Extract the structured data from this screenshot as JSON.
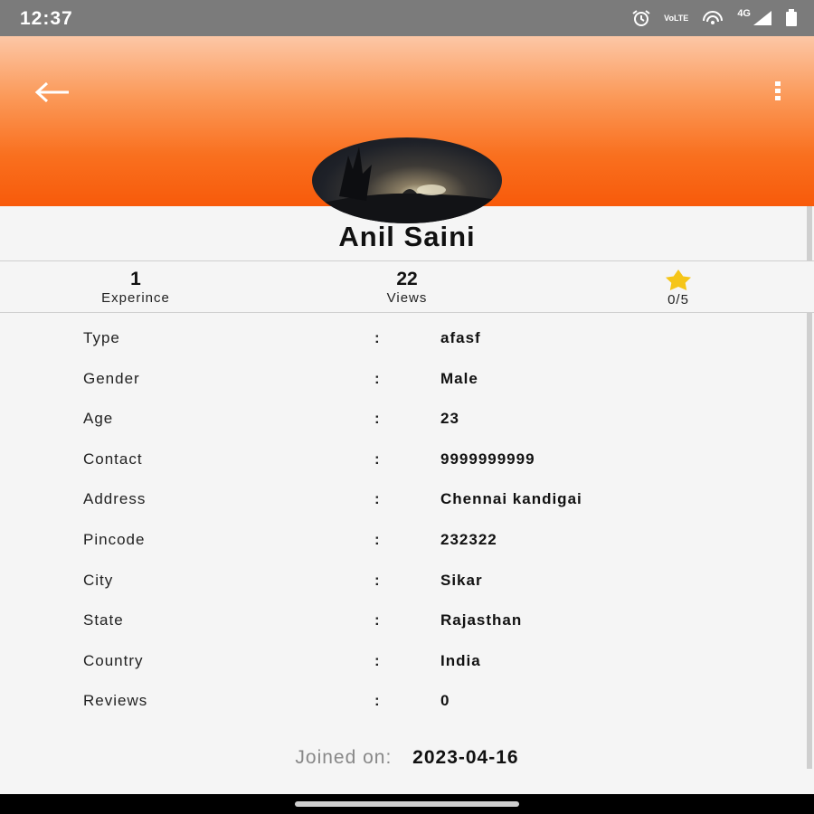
{
  "status_bar": {
    "time": "12:37",
    "icons": [
      "alarm-icon",
      "volte-icon",
      "hotspot-icon",
      "4g-signal-icon",
      "battery-icon"
    ],
    "network_label": "4G",
    "volte_label": "VoLTE"
  },
  "header": {
    "back_icon": "arrow-left-icon",
    "menu_icon": "more-vertical-icon",
    "gradient_colors": [
      "#fcc7a6",
      "#f85a0a"
    ]
  },
  "profile": {
    "name": "Anil Saini"
  },
  "stats": {
    "experience": {
      "value": "1",
      "label": "Experince"
    },
    "views": {
      "value": "22",
      "label": "Views"
    },
    "rating": {
      "label": "0/5",
      "icon": "star-icon",
      "color": "#f5c518"
    }
  },
  "details": [
    {
      "label": "Type",
      "value": "afasf"
    },
    {
      "label": "Gender",
      "value": "Male"
    },
    {
      "label": "Age",
      "value": "23"
    },
    {
      "label": "Contact",
      "value": "9999999999"
    },
    {
      "label": "Address",
      "value": "Chennai kandigai"
    },
    {
      "label": "Pincode",
      "value": "232322"
    },
    {
      "label": "City",
      "value": "Sikar"
    },
    {
      "label": "State",
      "value": "Rajasthan"
    },
    {
      "label": "Country",
      "value": "India"
    },
    {
      "label": "Reviews",
      "value": "0"
    }
  ],
  "separator": ":",
  "joined": {
    "label": "Joined on:",
    "date": "2023-04-16"
  }
}
